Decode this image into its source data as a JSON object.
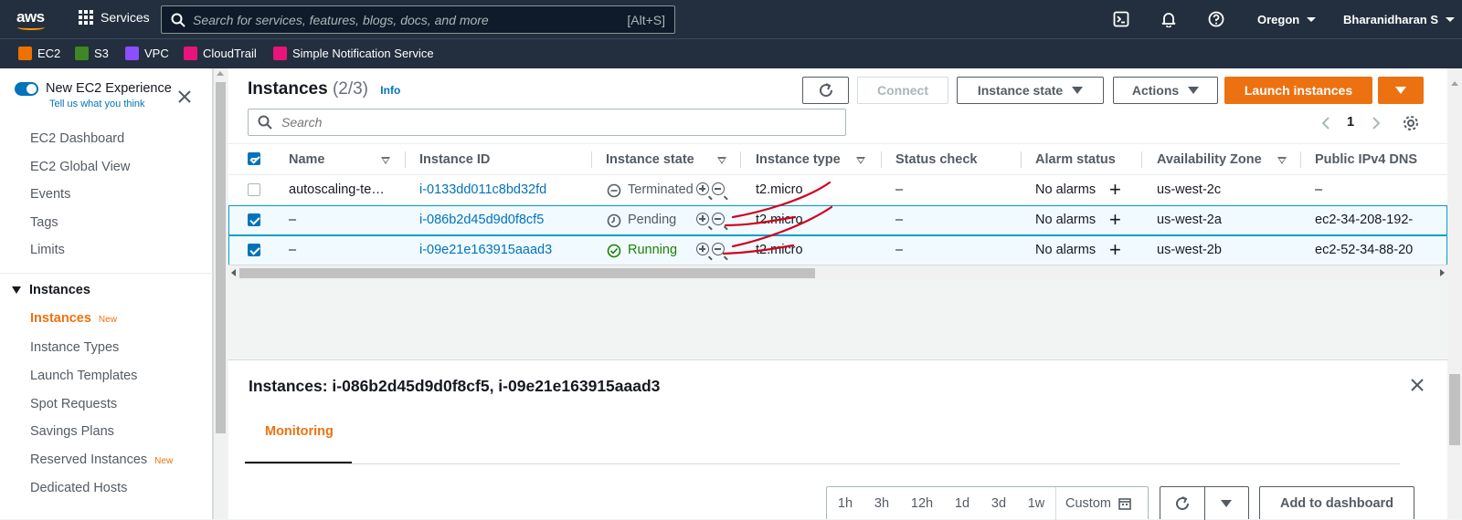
{
  "topnav": {
    "logo": "aws",
    "services_label": "Services",
    "search_placeholder": "Search for services, features, blogs, docs, and more",
    "search_shortcut": "[Alt+S]",
    "region": "Oregon",
    "user": "Bharanidharan S"
  },
  "bookmarks": [
    {
      "label": "EC2",
      "color": "#ed7100"
    },
    {
      "label": "S3",
      "color": "#3f8624"
    },
    {
      "label": "VPC",
      "color": "#8c4fff"
    },
    {
      "label": "CloudTrail",
      "color": "#e7157b"
    },
    {
      "label": "Simple Notification Service",
      "color": "#e7157b"
    }
  ],
  "sidebar": {
    "experience_title": "New EC2 Experience",
    "experience_link": "Tell us what you think",
    "items": [
      "EC2 Dashboard",
      "EC2 Global View",
      "Events",
      "Tags",
      "Limits"
    ],
    "section": "Instances",
    "sub_items": [
      {
        "label": "Instances",
        "badge": "New"
      },
      {
        "label": "Instance Types",
        "badge": ""
      },
      {
        "label": "Launch Templates",
        "badge": ""
      },
      {
        "label": "Spot Requests",
        "badge": ""
      },
      {
        "label": "Savings Plans",
        "badge": ""
      },
      {
        "label": "Reserved Instances",
        "badge": "New"
      },
      {
        "label": "Dedicated Hosts",
        "badge": ""
      }
    ]
  },
  "header": {
    "title": "Instances",
    "count": "(2/3)",
    "info": "Info",
    "connect": "Connect",
    "instance_state": "Instance state",
    "actions": "Actions",
    "launch": "Launch instances",
    "search_placeholder": "Search",
    "page": "1"
  },
  "table": {
    "columns": [
      "Name",
      "Instance ID",
      "Instance state",
      "Instance type",
      "Status check",
      "Alarm status",
      "Availability Zone",
      "Public IPv4 DNS"
    ],
    "rows": [
      {
        "name": "autoscaling-te…",
        "id": "i-0133dd011c8bd32fd",
        "state": "Terminated",
        "type": "t2.micro",
        "status": "–",
        "alarm": "No alarms",
        "az": "us-west-2c",
        "dns": "–",
        "selected": false
      },
      {
        "name": "–",
        "id": "i-086b2d45d9d0f8cf5",
        "state": "Pending",
        "type": "t2.micro",
        "status": "–",
        "alarm": "No alarms",
        "az": "us-west-2a",
        "dns": "ec2-34-208-192-",
        "selected": true
      },
      {
        "name": "–",
        "id": "i-09e21e163915aaad3",
        "state": "Running",
        "type": "t2.micro",
        "status": "–",
        "alarm": "No alarms",
        "az": "us-west-2b",
        "dns": "ec2-52-34-88-20",
        "selected": true
      }
    ]
  },
  "panel": {
    "title": "Instances: i-086b2d45d9d0f8cf5, i-09e21e163915aaad3",
    "tab": "Monitoring",
    "time_ranges": [
      "1h",
      "3h",
      "12h",
      "1d",
      "3d",
      "1w",
      "Custom"
    ],
    "add_dashboard": "Add to dashboard"
  },
  "colors": {
    "accent": "#ec7211",
    "link": "#0073bb",
    "nav": "#232f3e",
    "running": "#1d8102",
    "annotation": "#d0021b"
  }
}
